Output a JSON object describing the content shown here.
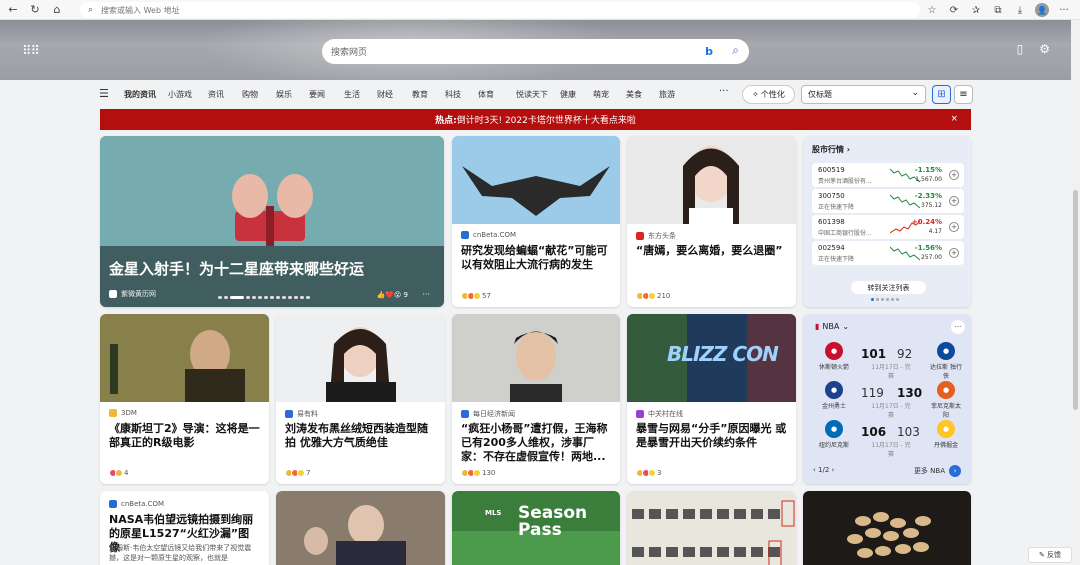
{
  "browser": {
    "address_placeholder": "搜索或输入 Web 地址",
    "avatar": "👤"
  },
  "search": {
    "placeholder": "搜索网页",
    "bing_label": "b"
  },
  "nav": {
    "categories": [
      "我的资讯",
      "小游戏",
      "资讯",
      "购物",
      "娱乐",
      "要闻",
      "生活",
      "财经",
      "教育",
      "科技",
      "体育",
      "悦读天下",
      "健康",
      "萌宠",
      "美食",
      "旅游"
    ],
    "more": "···",
    "personalize": "个性化",
    "select_value": "仅标题"
  },
  "banner": {
    "prefix": "热点:",
    "text": "倒计时3天! 2022卡塔尔世界杯十大看点来啦",
    "close": "×"
  },
  "cards": {
    "hero": {
      "title": "金星入射手！为十二星座带来哪些好运",
      "source": "紫微黄历网",
      "count": "9",
      "more": "···"
    },
    "c2": {
      "source": "cnBeta.COM",
      "title": "研究发现给蝙蝠“献花”可能可以有效阻止大流行病的发生",
      "count": "57"
    },
    "c3": {
      "source": "东方头条",
      "title": "“唐嫣，要么离婚，要么退圈”",
      "count": "210"
    },
    "c4": {
      "source": "3DM",
      "title": "《康斯坦丁2》导演：这将是一部真正的R级电影",
      "count": "4"
    },
    "c5": {
      "source": "易有料",
      "title": "刘涛发布黑丝绒短西装造型随拍 优雅大方气质绝佳",
      "count": "7"
    },
    "c6": {
      "source": "每日经济新闻",
      "title": "“疯狂小杨哥”遭打假，王海称已有200多人维权，涉事厂家：不存在虚假宣传！两地...",
      "count": "130"
    },
    "c7": {
      "source": "中关村在线",
      "title": "暴雪与网易“分手”原因曝光 或是暴雪开出天价续约条件",
      "count": "3",
      "img_text": "BLIZZ CON"
    },
    "c8": {
      "source": "cnBeta.COM",
      "title": "NASA韦伯望远镜拍摄到绚丽的原星L1527“火红沙漏”图像",
      "snippet": "詹姆斯·韦伯太空望远镜又给我们带来了视觉震撼，这是对一颗原生星的观察，也就是"
    },
    "c10": {
      "img_text_1": "MLS",
      "img_text_2": "Season",
      "img_text_3": "Pass"
    }
  },
  "stocks": {
    "header": "股市行情",
    "rows": [
      {
        "code": "600519",
        "name": "贵州茅台酒股份有...",
        "pct": "-1.15%",
        "price": "1,567.00",
        "color": "#1e8a3c"
      },
      {
        "code": "300750",
        "name": "正在快速下降",
        "pct": "-2.33%",
        "price": "375.12",
        "color": "#1e8a3c"
      },
      {
        "code": "601398",
        "name": "中国工商银行股份...",
        "pct": "+0.24%",
        "price": "4.17",
        "color": "#d8281d"
      },
      {
        "code": "002594",
        "name": "正在快速下降",
        "pct": "-1.56%",
        "price": "257.00",
        "color": "#1e8a3c"
      }
    ],
    "button": "转到关注列表"
  },
  "nba": {
    "header": "NBA",
    "games": [
      {
        "home": "休斯顿火箭",
        "home_score": "101",
        "away_score": "92",
        "away": "达拉斯 独行侠",
        "date": "11月17日 - 完赛"
      },
      {
        "home": "金州勇士",
        "home_score": "119",
        "away_score": "130",
        "away": "菲尼克斯太阳",
        "date": "11月17日 - 完赛"
      },
      {
        "home": "纽约尼克斯",
        "home_score": "106",
        "away_score": "103",
        "away": "丹佛掘金",
        "date": "11月17日 - 完赛"
      }
    ],
    "page": "1/2",
    "more": "更多 NBA"
  },
  "feedback": "反馈"
}
